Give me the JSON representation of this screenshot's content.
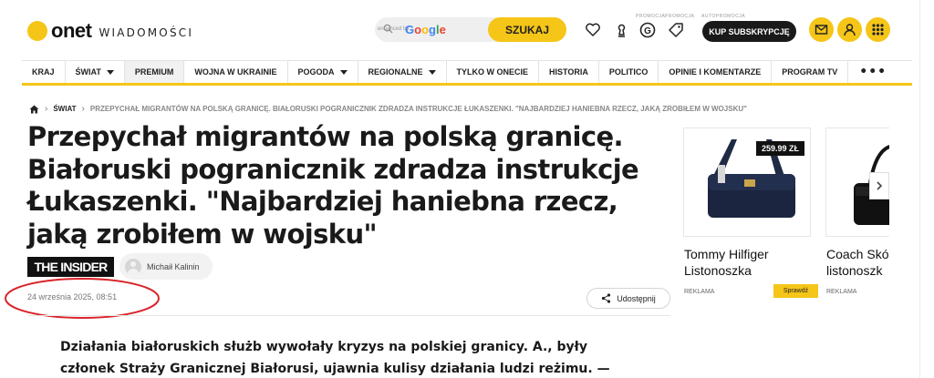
{
  "header": {
    "logo": "onet",
    "section": "WIADOMOŚCI",
    "search": {
      "placeholder": "",
      "enhanced_by": "enhanced by",
      "google": "Google",
      "button": "SZUKAJ"
    },
    "promo_label_1": "PROMOCJA",
    "promo_label_2": "PROMOCJA",
    "promo_label_3": "AUTOPROMOCJA",
    "subscribe_button": "KUP SUBSKRYPCJĘ",
    "icons": [
      "search-icon",
      "heart-icon",
      "horoscope-icon",
      "g-promo-icon",
      "tag-promo-icon",
      "mail-icon",
      "user-icon",
      "grid-icon"
    ]
  },
  "nav": {
    "items": [
      {
        "label": "KRAJ",
        "dropdown": false
      },
      {
        "label": "ŚWIAT",
        "dropdown": true
      },
      {
        "label": "PREMIUM",
        "dropdown": false
      },
      {
        "label": "WOJNA W UKRAINIE",
        "dropdown": false
      },
      {
        "label": "POGODA",
        "dropdown": true
      },
      {
        "label": "REGIONALNE",
        "dropdown": true
      },
      {
        "label": "TYLKO W ONECIE",
        "dropdown": false
      },
      {
        "label": "HISTORIA",
        "dropdown": false
      },
      {
        "label": "POLITICO",
        "dropdown": false
      },
      {
        "label": "OPINIE I KOMENTARZE",
        "dropdown": false
      },
      {
        "label": "PROGRAM TV",
        "dropdown": false
      }
    ],
    "more": "•••"
  },
  "breadcrumb": {
    "section": "ŚWIAT",
    "current": "PRZEPYCHAŁ MIGRANTÓW NA POLSKĄ GRANICĘ. BIAŁORUSKI POGRANICZNIK ZDRADZA INSTRUKCJE ŁUKASZENKI. \"NAJBARDZIEJ HANIEBNA RZECZ, JAKĄ ZROBIŁEM W WOJSKU\""
  },
  "article": {
    "headline": "Przepychał migrantów na polską granicę. Białoruski pogranicznik zdradza instrukcje Łukaszenki. \"Najbardziej haniebna rzecz, jaką zrobiłem w wojsku\"",
    "source": "THE INSIDER",
    "author": "Michaił Kalinin",
    "date": "24 września 2025, 08:51",
    "share": "Udostępnij",
    "lead": "Działania białoruskich służb wywołały kryzys na polskiej granicy. A., były członek Straży Granicznej Białorusi, ujawnia kulisy działania ludzi reżimu. —"
  },
  "products": [
    {
      "name_line1": "Tommy Hilfiger",
      "name_line2": "Listonoszka",
      "price": "259.99 ZŁ",
      "tag": "REKLAMA",
      "button": "Sprawdź"
    },
    {
      "name_line1": "Coach Skó",
      "name_line2": "listonoszk",
      "tag": "REKLAMA"
    }
  ],
  "colors": {
    "accent": "#f5c518",
    "annotation": "#d9252a",
    "text": "#1a1a1a"
  }
}
